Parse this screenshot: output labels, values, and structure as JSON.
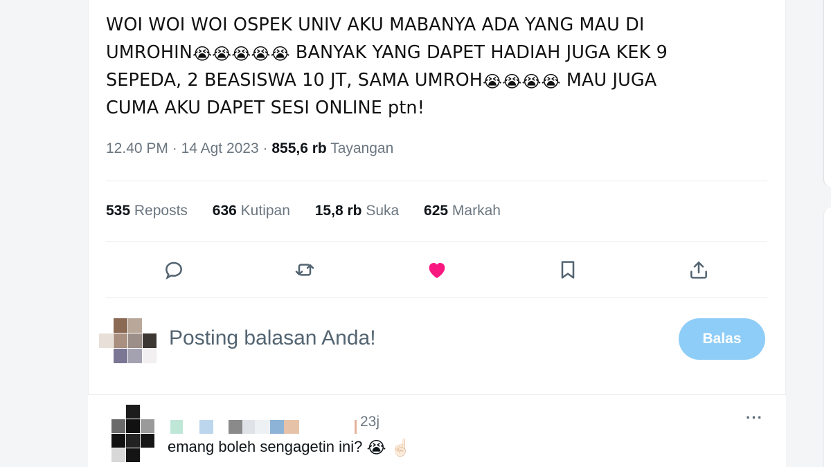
{
  "tweet": {
    "line1": "WOI WOI WOI OSPEK UNIV AKU MABANYA ADA YANG MAU DI",
    "line2_a": "UMROHIN",
    "line2_b": " BANYAK YANG DAPET HADIAH JUGA KEK 9",
    "line3_a": "SEPEDA, 2 BEASISWA 10 JT, SAMA UMROH",
    "line3_b": " MAU JUGA",
    "line4": "CUMA AKU DAPET SESI ONLINE ptn!",
    "emoji": "😭"
  },
  "meta": {
    "time": "12.40 PM",
    "sep": " · ",
    "date": "14 Agt 2023",
    "views_count": "855,6 rb",
    "views_label": "Tayangan"
  },
  "stats": [
    {
      "count": "535",
      "label": "Reposts"
    },
    {
      "count": "636",
      "label": "Kutipan"
    },
    {
      "count": "15,8 rb",
      "label": "Suka"
    },
    {
      "count": "625",
      "label": "Markah"
    }
  ],
  "actions": {
    "reply_icon": "reply-icon",
    "repost_icon": "repost-icon",
    "like_icon": "heart-filled-icon",
    "bookmark_icon": "bookmark-icon",
    "share_icon": "share-icon",
    "like_color": "#f91880"
  },
  "reply_box": {
    "placeholder": "Posting balasan Anda!",
    "button": "Balas"
  },
  "comment": {
    "time": "23j",
    "more": "···",
    "text": "emang boleh sengagetin ini?",
    "emoji": "😭",
    "emoji2": "☝🏻"
  }
}
